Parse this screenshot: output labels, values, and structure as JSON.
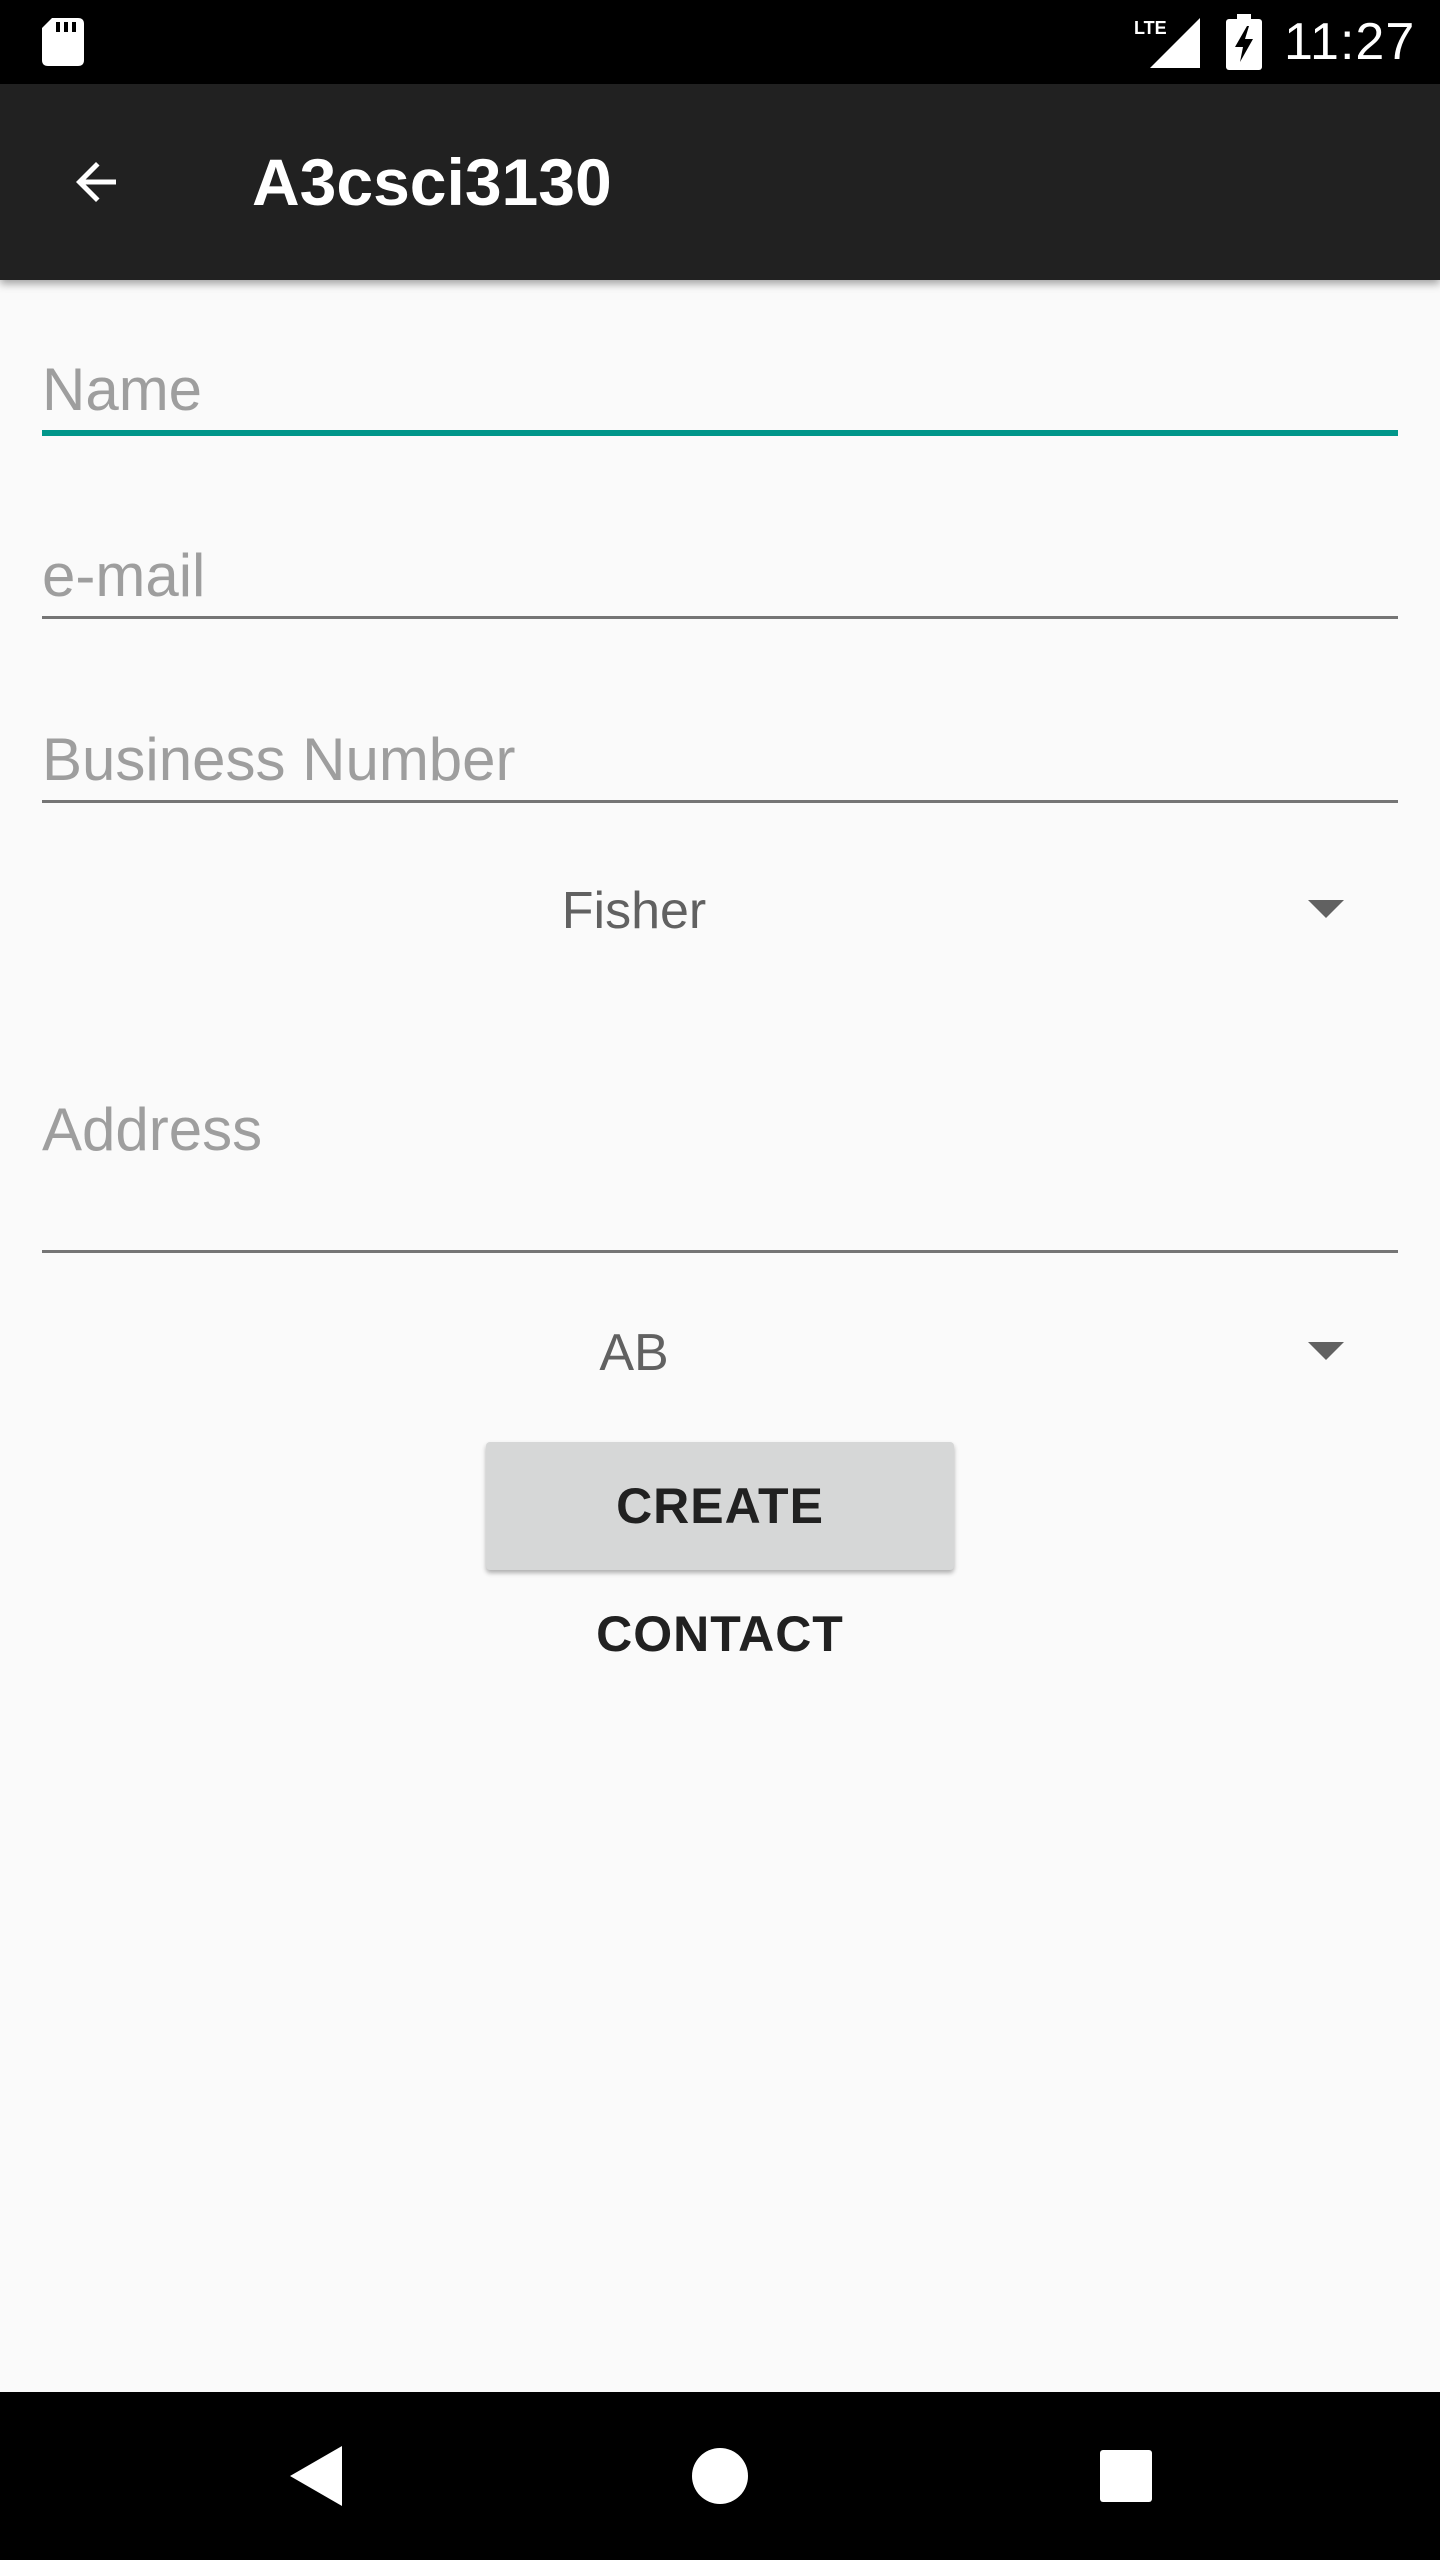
{
  "status_bar": {
    "network_label": "LTE",
    "time": "11:27",
    "icons": [
      "sd-card-icon",
      "lte-signal-icon",
      "battery-charging-icon"
    ]
  },
  "app_bar": {
    "title": "A3csci3130",
    "back_icon": "arrow-back-icon"
  },
  "form": {
    "name": {
      "placeholder": "Name",
      "value": ""
    },
    "email": {
      "placeholder": "e-mail",
      "value": ""
    },
    "business_number": {
      "placeholder": "Business Number",
      "value": ""
    },
    "business_type": {
      "selected": "Fisher"
    },
    "address": {
      "placeholder": "Address",
      "value": ""
    },
    "province": {
      "selected": "AB"
    },
    "create_button_label": "CREATE CONTACT"
  },
  "colors": {
    "status_bar": "#000000",
    "app_bar": "#212121",
    "background": "#fafafa",
    "accent": "#00968a",
    "hint_text": "#9e9e9e",
    "button": "#d6d7d7"
  },
  "nav_bar": {
    "buttons": [
      "back-triangle-icon",
      "home-circle-icon",
      "recents-square-icon"
    ]
  }
}
